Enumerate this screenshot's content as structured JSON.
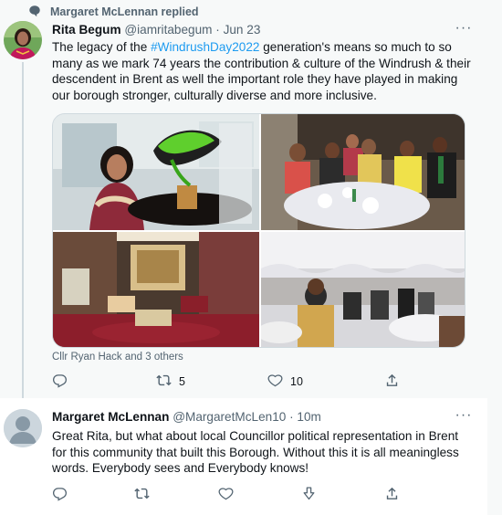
{
  "replied": {
    "label": "Margaret McLennan replied"
  },
  "tweet1": {
    "name": "Rita Begum",
    "handle": "@iamritabegum",
    "dot": "·",
    "time": "Jun 23",
    "text_before": "The legacy of the ",
    "hashtag": "#WindrushDay2022",
    "text_after": " generation's means so much to so many as we mark 74 years the contribution & culture of the Windrush & their descendent in Brent as well the important role they have played in making our borough stronger, culturally diverse and more inclusive.",
    "tagged": "Cllr Ryan Hack and 3 others",
    "retweet_count": "5",
    "like_count": "10"
  },
  "tweet2": {
    "name": "Margaret McLennan",
    "handle": "@MargaretMcLen10",
    "dot": "·",
    "time": "10m",
    "text": "Great Rita, but what about local Councillor political representation in Brent for this community that built this Borough. Without this it is all meaningless words. Everybody sees and Everybody knows!"
  },
  "more_label": "···",
  "icons": {
    "replied": "comment-icon",
    "reply": "reply-icon",
    "retweet": "retweet-icon",
    "like": "heart-icon",
    "share": "share-icon",
    "downvote": "downvote-icon",
    "more": "more-icon"
  },
  "colors": {
    "accent": "#1d9bf0",
    "muted": "#536471",
    "text": "#0f1419",
    "thread_line": "#cfd9de"
  }
}
